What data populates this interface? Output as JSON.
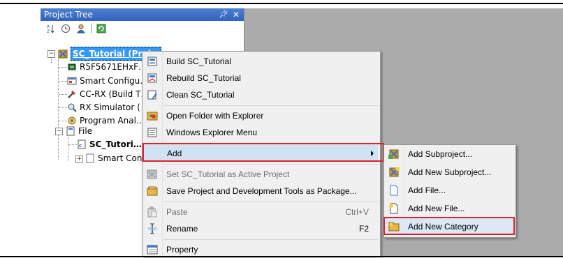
{
  "panel": {
    "title": "Project Tree",
    "pin_glyph": "p",
    "close_glyph": "✕",
    "toolbar": [
      {
        "name": "sort-icon",
        "glyph": "⇅"
      },
      {
        "name": "clock-icon",
        "glyph": "◷"
      },
      {
        "name": "person-icon",
        "glyph": "☺"
      },
      {
        "name": "refresh-icon",
        "glyph": "↻"
      }
    ]
  },
  "tree": {
    "root": "SC_Tutorial (Proj…",
    "items": [
      "R5F5671EHxF…",
      "Smart Configu…",
      "CC-RX (Build T…",
      "RX Simulator (",
      "Program Anal…",
      "File",
      "SC_Tutori…",
      "Smart Con…"
    ]
  },
  "context_menu": {
    "items": [
      {
        "label": "Build SC_Tutorial",
        "icon": "build-icon",
        "disabled": false,
        "shortcut": ""
      },
      {
        "label": "Rebuild SC_Tutorial",
        "icon": "rebuild-icon",
        "disabled": false,
        "shortcut": ""
      },
      {
        "label": "Clean SC_Tutorial",
        "icon": "clean-icon",
        "disabled": false,
        "shortcut": ""
      },
      {
        "label": "Open Folder with Explorer",
        "icon": "open-folder-icon",
        "disabled": false,
        "shortcut": ""
      },
      {
        "label": "Windows Explorer Menu",
        "icon": "explorer-menu-icon",
        "disabled": false,
        "shortcut": ""
      },
      {
        "label": "Add",
        "icon": "",
        "disabled": false,
        "shortcut": "",
        "submenu": true
      },
      {
        "label": "Set SC_Tutorial as Active Project",
        "icon": "active-project-icon",
        "disabled": true,
        "shortcut": ""
      },
      {
        "label": "Save Project and Development Tools as Package...",
        "icon": "package-icon",
        "disabled": false,
        "shortcut": ""
      },
      {
        "label": "Paste",
        "icon": "paste-icon",
        "disabled": true,
        "shortcut": "Ctrl+V"
      },
      {
        "label": "Rename",
        "icon": "rename-icon",
        "disabled": false,
        "shortcut": "F2"
      },
      {
        "label": "Property",
        "icon": "property-icon",
        "disabled": false,
        "shortcut": ""
      }
    ]
  },
  "submenu": {
    "items": [
      {
        "label": "Add Subproject...",
        "icon": "add-subproject-icon"
      },
      {
        "label": "Add New Subproject...",
        "icon": "add-new-subproject-icon"
      },
      {
        "label": "Add File...",
        "icon": "add-file-icon"
      },
      {
        "label": "Add New File...",
        "icon": "add-new-file-icon"
      },
      {
        "label": "Add New Category",
        "icon": "add-new-category-icon"
      }
    ]
  },
  "colors": {
    "highlight": "#e21f2a",
    "selection": "#3399ff",
    "title_bar": "#3d6fc8"
  }
}
